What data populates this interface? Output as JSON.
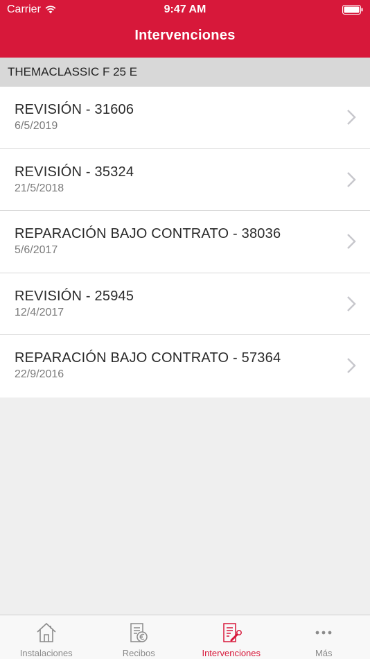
{
  "status_bar": {
    "carrier": "Carrier",
    "time": "9:47 AM"
  },
  "nav": {
    "title": "Intervenciones"
  },
  "section": {
    "title": "THEMACLASSIC F 25 E"
  },
  "interventions": [
    {
      "title": "REVISIÓN - 31606",
      "date": "6/5/2019"
    },
    {
      "title": "REVISIÓN - 35324",
      "date": "21/5/2018"
    },
    {
      "title": "REPARACIÓN BAJO CONTRATO - 38036",
      "date": "5/6/2017"
    },
    {
      "title": "REVISIÓN - 25945",
      "date": "12/4/2017"
    },
    {
      "title": "REPARACIÓN BAJO CONTRATO - 57364",
      "date": "22/9/2016"
    }
  ],
  "tabs": [
    {
      "label": "Instalaciones",
      "icon": "house-icon",
      "active": false
    },
    {
      "label": "Recibos",
      "icon": "receipt-euro-icon",
      "active": false
    },
    {
      "label": "Intervenciones",
      "icon": "document-wrench-icon",
      "active": true
    },
    {
      "label": "Más",
      "icon": "more-dots-icon",
      "active": false
    }
  ],
  "colors": {
    "brand": "#d7183a",
    "tab_inactive": "#8a8a8a",
    "background": "#efefef"
  }
}
